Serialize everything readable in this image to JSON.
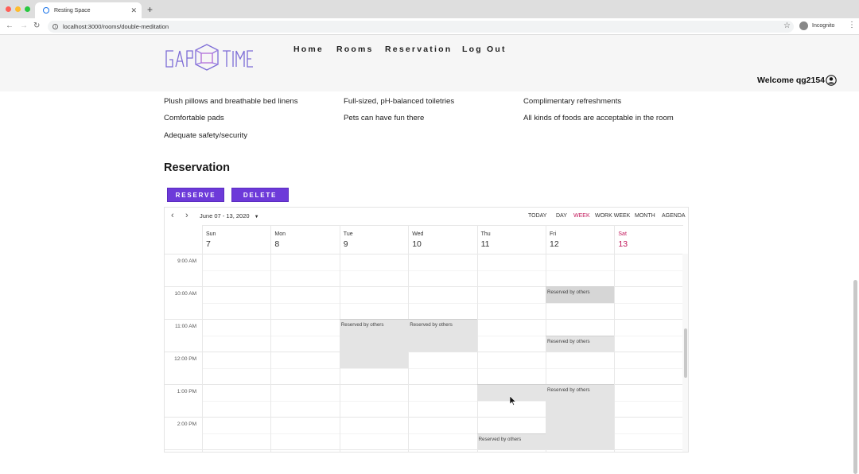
{
  "browser": {
    "tab_title": "Resting Space",
    "url": "localhost:3000/rooms/double-meditation",
    "incognito_label": "Incognito"
  },
  "site": {
    "logo_text": "GAP TIME",
    "nav": [
      "Home",
      "Rooms",
      "Reservation",
      "Log Out"
    ],
    "welcome": "Welcome qg2154"
  },
  "amenities": [
    "Plush pillows and breathable bed linens",
    "Full-sized, pH-balanced toiletries",
    "Complimentary refreshments",
    "Comfortable pads",
    "Pets can have fun there",
    "All kinds of foods are acceptable in the room",
    "Adequate safety/security"
  ],
  "reservation": {
    "title": "Reservation",
    "reserve_label": "RESERVE",
    "delete_label": "DELETE"
  },
  "calendar": {
    "range_label": "June 07 - 13, 2020",
    "views": [
      "TODAY",
      "DAY",
      "WEEK",
      "WORK WEEK",
      "MONTH",
      "AGENDA"
    ],
    "active_view": "WEEK",
    "days": [
      {
        "name": "Sun",
        "num": "7"
      },
      {
        "name": "Mon",
        "num": "8"
      },
      {
        "name": "Tue",
        "num": "9"
      },
      {
        "name": "Wed",
        "num": "10"
      },
      {
        "name": "Thu",
        "num": "11"
      },
      {
        "name": "Fri",
        "num": "12"
      },
      {
        "name": "Sat",
        "num": "13"
      }
    ],
    "times": [
      "9:00 AM",
      "10:00 AM",
      "11:00 AM",
      "12:00 PM",
      "1:00 PM",
      "2:00 PM"
    ],
    "event_label": "Reserved by others",
    "events": [
      {
        "day": 5,
        "start": "10:00",
        "end": "10:30",
        "label": "Reserved by others"
      },
      {
        "day": 2,
        "start": "11:00",
        "end": "12:30",
        "label": "Reserved by others"
      },
      {
        "day": 3,
        "start": "11:00",
        "end": "12:00",
        "label": "Reserved by others"
      },
      {
        "day": 5,
        "start": "11:30",
        "end": "12:00",
        "label": "Reserved by others"
      },
      {
        "day": 4,
        "start": "13:00",
        "end": "13:30",
        "label": ""
      },
      {
        "day": 5,
        "start": "13:00",
        "end": "15:00",
        "label": "Reserved by others"
      },
      {
        "day": 4,
        "start": "14:30",
        "end": "15:00",
        "label": "Reserved by others"
      }
    ]
  }
}
